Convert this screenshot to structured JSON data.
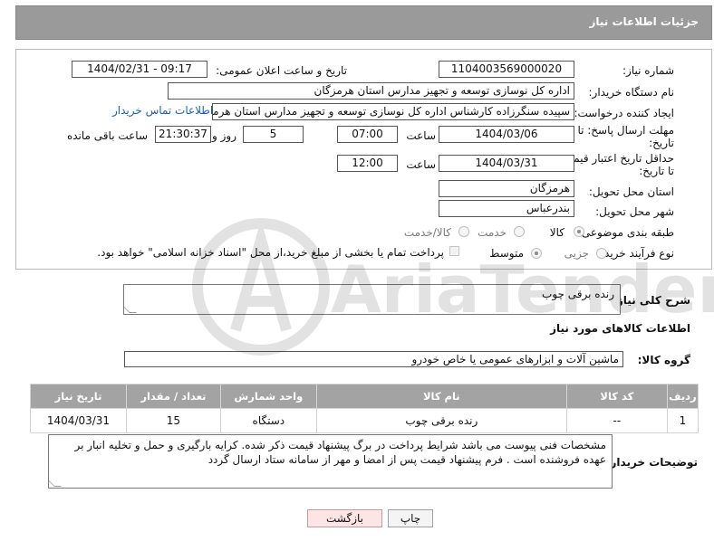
{
  "header": {
    "title": "جزئیات اطلاعات نیاز"
  },
  "form": {
    "need_number_label": "شماره نیاز:",
    "need_number": "1104003569000020",
    "announce_label": "تاریخ و ساعت اعلان عمومی:",
    "announce_value": "1404/02/31 - 09:17",
    "buyer_org_label": "نام دستگاه خریدار:",
    "buyer_org": "اداره کل نوسازی  توسعه و تجهیز مدارس استان هرمزگان",
    "requester_label": "ایجاد کننده درخواست:",
    "requester": "سپیده سنگرزاده کارشناس اداره کل نوسازی  توسعه و تجهیز مدارس استان هرمزگان",
    "contact_link": "اطلاعات تماس خریدار",
    "deadline_label_1": "مهلت ارسال پاسخ: تا",
    "deadline_label_2": "تاریخ:",
    "deadline_date": "1404/03/06",
    "time_label": "ساعت",
    "deadline_time": "07:00",
    "days_value": "5",
    "days_label": "روز و",
    "remaining_time": "21:30:37",
    "remaining_label": "ساعت باقی مانده",
    "price_valid_label_1": "حداقل تاریخ اعتبار قیمت:",
    "price_valid_label_2": "تا تاریخ:",
    "price_valid_date": "1404/03/31",
    "price_valid_time": "12:00",
    "province_label": "استان محل تحویل:",
    "province": "هرمزگان",
    "city_label": "شهر محل تحویل:",
    "city": "بندرعباس",
    "category_label": "طبقه بندی موضوعی:",
    "category_options": [
      "کالا",
      "خدمت",
      "کالا/خدمت"
    ],
    "category_selected": "کالا",
    "process_label": "نوع فرآیند خرید :",
    "process_options": [
      "جزیی",
      "متوسط"
    ],
    "process_selected": "متوسط",
    "payment_note": "پرداخت تمام یا بخشی از مبلغ خرید،از محل \"اسناد خزانه اسلامی\" خواهد بود."
  },
  "need_desc": {
    "label": "شرح کلی نیاز:",
    "value": "رنده برقی چوب"
  },
  "goods_section_title": "اطلاعات کالاهای مورد نیاز",
  "goods_group": {
    "label": "گروه کالا:",
    "value": "ماشین آلات و ابزارهای عمومی یا خاص خودرو"
  },
  "table": {
    "headers": [
      "ردیف",
      "کد کالا",
      "نام کالا",
      "واحد شمارش",
      "تعداد / مقدار",
      "تاریخ نیاز"
    ],
    "rows": [
      [
        "1",
        "--",
        "رنده برقی چوب",
        "دستگاه",
        "15",
        "1404/03/31"
      ]
    ]
  },
  "buyer_notes": {
    "label": "توضیحات خریدار:",
    "value": "مشخصات فنی پیوست می باشد شرایط پرداخت در برگ پیشنهاد قیمت ذکر شده. کرایه بارگیری و حمل و تخلیه انبار بر عهده فروشنده است . فرم پیشنهاد قیمت پس از امضا و مهر از سامانه ستاد ارسال گردد"
  },
  "buttons": {
    "print": "چاپ",
    "back": "بازگشت"
  },
  "watermark": {
    "text": "AriaTender.net"
  }
}
